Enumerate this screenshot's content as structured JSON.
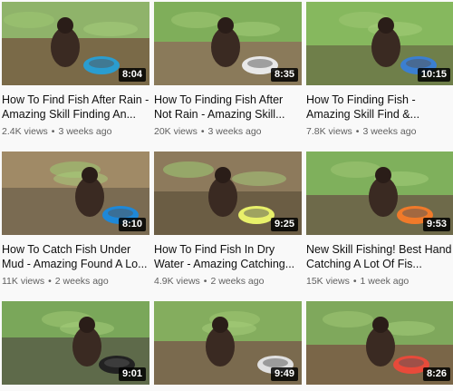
{
  "videos": [
    {
      "title": "How To Find Fish After Rain - Amazing Skill Finding An...",
      "views": "2.4K views",
      "age": "3 weeks ago",
      "duration": "8:04",
      "colors": {
        "sky": "#8fb36a",
        "ground": "#7a6a48",
        "accent": "#2a9dd0"
      }
    },
    {
      "title": "How To Finding Fish After Not Rain - Amazing Skill...",
      "views": "20K views",
      "age": "3 weeks ago",
      "duration": "8:35",
      "colors": {
        "sky": "#7fae5a",
        "ground": "#8a7a5a",
        "accent": "#e8e8e8"
      }
    },
    {
      "title": "How To Finding Fish - Amazing Skill Find &...",
      "views": "7.8K views",
      "age": "3 weeks ago",
      "duration": "10:15",
      "colors": {
        "sky": "#86b85e",
        "ground": "#6f7f4a",
        "accent": "#3b7fd1"
      }
    },
    {
      "title": "How To Catch Fish Under Mud - Amazing Found A Lo...",
      "views": "11K views",
      "age": "2 weeks ago",
      "duration": "8:10",
      "colors": {
        "sky": "#a08a66",
        "ground": "#7a6b52",
        "accent": "#1e88d8"
      }
    },
    {
      "title": "How To Find Fish In Dry Water - Amazing Catching...",
      "views": "4.9K views",
      "age": "2 weeks ago",
      "duration": "9:25",
      "colors": {
        "sky": "#8d7a5c",
        "ground": "#6b5d44",
        "accent": "#e8f06a"
      }
    },
    {
      "title": "New Skill Fishing! Best Hand Catching A Lot Of Fis...",
      "views": "15K views",
      "age": "1 week ago",
      "duration": "9:53",
      "colors": {
        "sky": "#7fb05c",
        "ground": "#6e6a4a",
        "accent": "#f07a2a"
      }
    },
    {
      "title": "",
      "views": "",
      "age": "",
      "duration": "9:01",
      "colors": {
        "sky": "#7aa75a",
        "ground": "#5e6a4a",
        "accent": "#222222"
      }
    },
    {
      "title": "",
      "views": "",
      "age": "",
      "duration": "9:49",
      "colors": {
        "sky": "#84ad5e",
        "ground": "#7a6a4e",
        "accent": "#e0e0e0"
      }
    },
    {
      "title": "",
      "views": "",
      "age": "",
      "duration": "8:26",
      "colors": {
        "sky": "#7fa85c",
        "ground": "#7a6648",
        "accent": "#e84a3a"
      }
    }
  ],
  "separator": "•"
}
